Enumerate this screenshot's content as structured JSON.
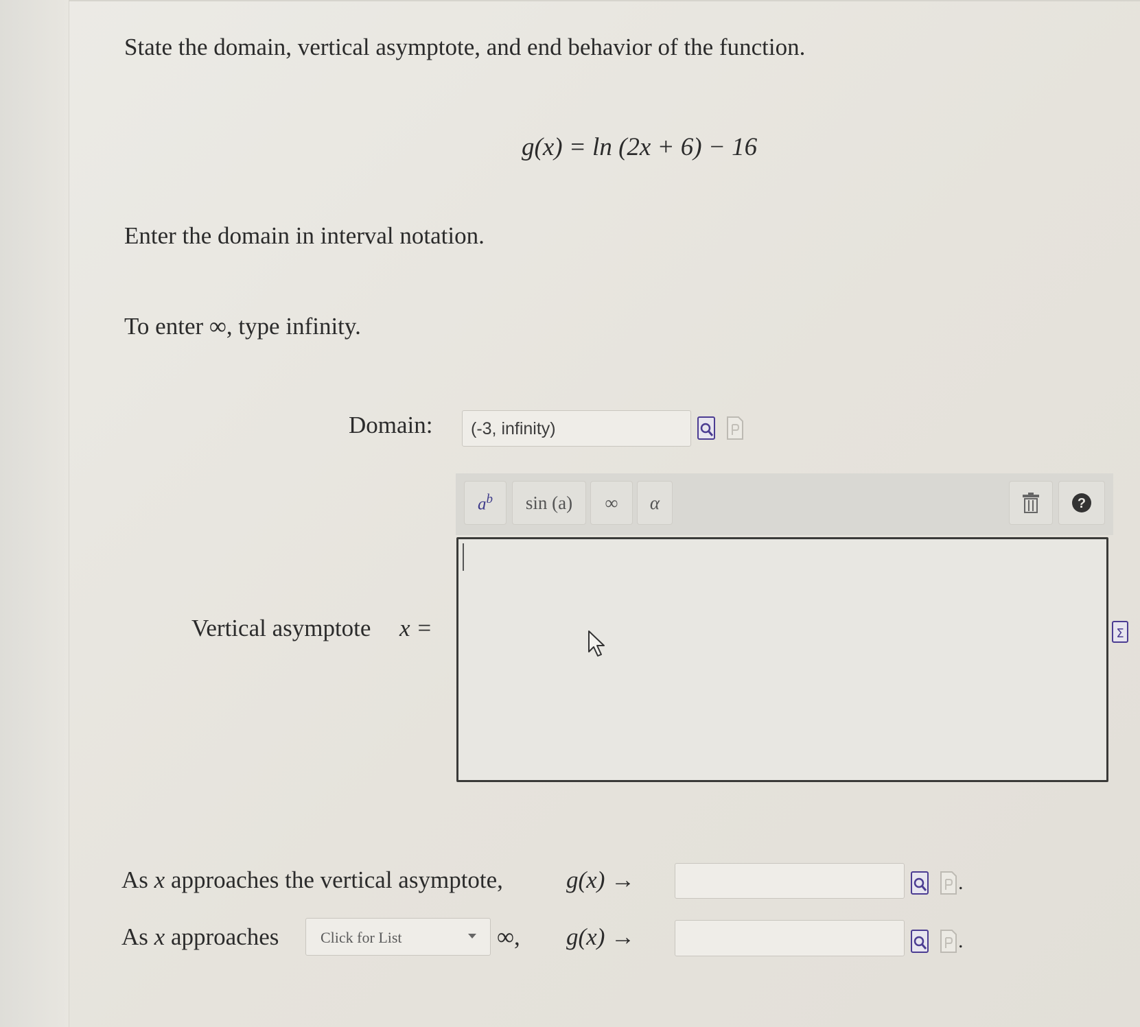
{
  "question": {
    "prompt": "State the domain, vertical asymptote, and end behavior of the function.",
    "equation": "g(x) = ln (2x + 6) − 16",
    "instruction_domain": "Enter the domain in interval notation.",
    "instruction_infinity": "To enter ∞, type infinity."
  },
  "domain": {
    "label": "Domain:",
    "value": "(-3, infinity)"
  },
  "math_toolbar": {
    "power_label": "ab",
    "sin_label": "sin (a)",
    "infinity_label": "∞",
    "alpha_label": "α"
  },
  "asymptote": {
    "label": "Vertical asymptote",
    "equation_label": "x =",
    "value": ""
  },
  "end_behavior": {
    "row1_text_before": "As",
    "row1_var": "x",
    "row1_text_after": "approaches the vertical asymptote,",
    "row1_func": "g(x) →",
    "row1_value": "",
    "row2_text_before": "As",
    "row2_var": "x",
    "row2_text_after": "approaches",
    "dropdown_placeholder": "Click for List",
    "row2_infinity": "∞,",
    "row2_func": "g(x) →",
    "row2_value": ""
  },
  "colors": {
    "icon_purple": "#4b3c92",
    "help_icon": "#333333"
  },
  "icons": [
    "preview-icon",
    "syntax-icon",
    "trash-icon",
    "help-icon",
    "equation-editor-icon",
    "cursor-pointer-icon"
  ]
}
